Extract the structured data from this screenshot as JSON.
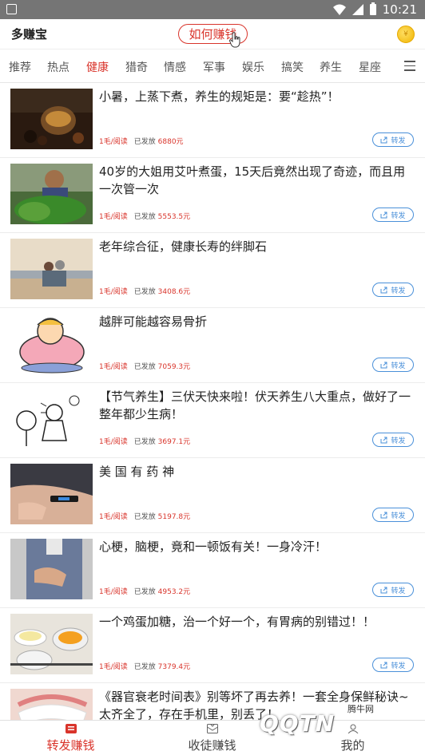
{
  "status_bar": {
    "time": "10:21"
  },
  "app": {
    "title": "多赚宝",
    "how_button": "如何赚钱"
  },
  "tabs": [
    "推荐",
    "热点",
    "健康",
    "猎奇",
    "情感",
    "军事",
    "娱乐",
    "搞笑",
    "养生",
    "星座"
  ],
  "active_tab": "健康",
  "articles": [
    {
      "title": "小暑，上蒸下煮，养生的规矩是：要“趁热”！",
      "price": "1毛/阅读",
      "paid_label": "已发放",
      "paid_value": "6880元",
      "share": "转发"
    },
    {
      "title": "40岁的大姐用艾叶煮蛋，15天后竟然出现了奇迹，而且用一次管一次",
      "price": "1毛/阅读",
      "paid_label": "已发放",
      "paid_value": "5553.5元",
      "share": "转发"
    },
    {
      "title": "老年综合征，健康长寿的绊脚石",
      "price": "1毛/阅读",
      "paid_label": "已发放",
      "paid_value": "3408.6元",
      "share": "转发"
    },
    {
      "title": "越胖可能越容易骨折",
      "price": "1毛/阅读",
      "paid_label": "已发放",
      "paid_value": "7059.3元",
      "share": "转发"
    },
    {
      "title": "【节气养生】三伏天快来啦！伏天养生八大重点，做好了一整年都少生病！",
      "price": "1毛/阅读",
      "paid_label": "已发放",
      "paid_value": "3697.1元",
      "share": "转发"
    },
    {
      "title": "美 国 有 药 神",
      "price": "1毛/阅读",
      "paid_label": "已发放",
      "paid_value": "5197.8元",
      "share": "转发"
    },
    {
      "title": "心梗，脑梗，竟和一顿饭有关！一身冷汗！",
      "price": "1毛/阅读",
      "paid_label": "已发放",
      "paid_value": "4953.2元",
      "share": "转发"
    },
    {
      "title": "一个鸡蛋加糖，治一个好一个，有胃病的别错过！！",
      "price": "1毛/阅读",
      "paid_label": "已发放",
      "paid_value": "7379.4元",
      "share": "转发"
    },
    {
      "title": "《器官衰老时间表》别等坏了再去养！一套全身保鲜秘诀~太齐全了，存在手机里，别丢了！",
      "price": "",
      "paid_label": "",
      "paid_value": "",
      "share": ""
    }
  ],
  "bottom_nav": {
    "items": [
      "转发赚钱",
      "收徒赚钱",
      "我的"
    ],
    "active": "转发赚钱"
  },
  "watermark": {
    "brand": "腾牛网",
    "logo": "QQTN"
  },
  "colors": {
    "accent": "#d9342b",
    "share_blue": "#4a90d9",
    "status_bar": "#757575"
  }
}
